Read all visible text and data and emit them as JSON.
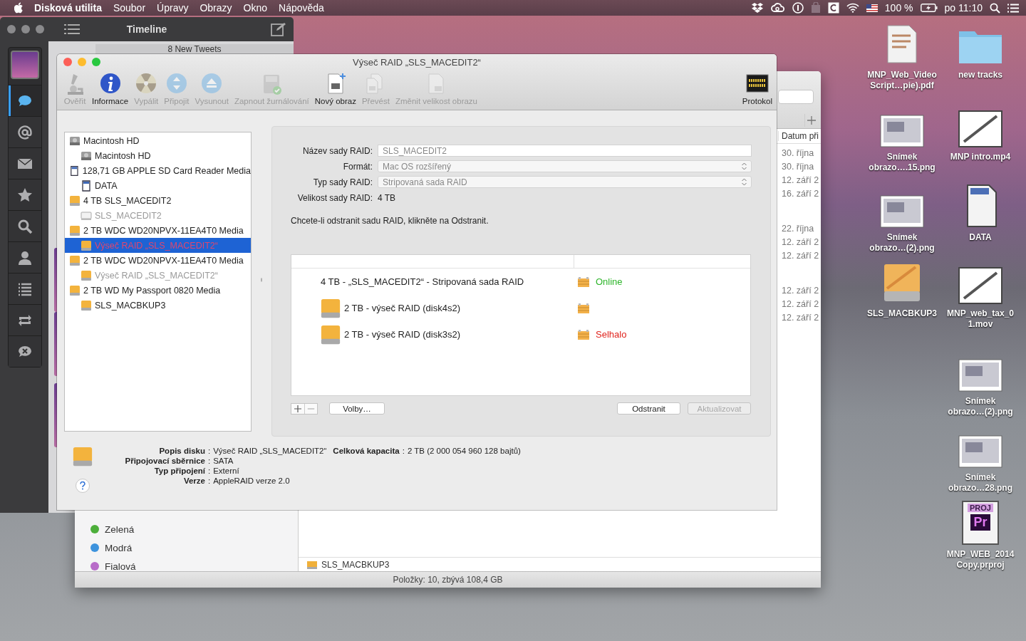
{
  "menu_bar": {
    "app": "Disková utilita",
    "items": [
      "Soubor",
      "Úpravy",
      "Obrazy",
      "Okno",
      "Nápověda"
    ],
    "battery": "100 %",
    "clock": "po 11:10"
  },
  "tweet_window": {
    "title": "Timeline",
    "banner": "8 New Tweets",
    "nav": [
      {
        "kind": "messages",
        "selected": true
      },
      {
        "kind": "mentions",
        "selected": false
      },
      {
        "kind": "mail",
        "selected": false
      },
      {
        "kind": "favorites",
        "selected": false
      },
      {
        "kind": "search",
        "selected": false
      },
      {
        "kind": "profile",
        "selected": false
      },
      {
        "kind": "lists",
        "selected": false
      },
      {
        "kind": "retweets",
        "selected": false
      },
      {
        "kind": "mutes",
        "selected": false
      }
    ]
  },
  "finder_window": {
    "date_header": "Datum při",
    "date_groups": [
      [
        "30. října",
        "30. října",
        "12. září 2",
        "16. září 2"
      ],
      [
        "22. října",
        "12. září 2",
        "12. září 2"
      ],
      [
        "12. září 2",
        "12. září 2",
        "12. září 2"
      ]
    ],
    "tags": [
      {
        "label": "Zelená",
        "color": "#4cae3a"
      },
      {
        "label": "Modrá",
        "color": "#3d93dd"
      },
      {
        "label": "Fialová",
        "color": "#b86cc9"
      }
    ],
    "path_item": "SLS_MACBKUP3",
    "status": "Položky: 10, zbývá 108,4 GB"
  },
  "disk_window": {
    "title": "Výseč RAID „SLS_MACEDIT2“",
    "toolbar": [
      {
        "kind": "verify",
        "label": "Ověřit",
        "disabled": true
      },
      {
        "kind": "info",
        "label": "Informace",
        "disabled": false
      },
      {
        "kind": "burn",
        "label": "Vypálit",
        "disabled": true
      },
      {
        "kind": "mount",
        "label": "Připojit",
        "disabled": true
      },
      {
        "kind": "eject",
        "label": "Vysunout",
        "disabled": true
      },
      {
        "kind": "journal",
        "label": "Zapnout žurnálování",
        "disabled": true
      },
      {
        "kind": "new-image",
        "label": "Nový obraz",
        "disabled": false
      },
      {
        "kind": "convert",
        "label": "Převést",
        "disabled": true
      },
      {
        "kind": "resize",
        "label": "Změnit velikost obrazu",
        "disabled": true
      },
      {
        "kind": "log",
        "label": "Protokol",
        "disabled": false
      }
    ],
    "disks": [
      {
        "kind": "hd",
        "name": "Macintosh HD",
        "selected": false,
        "disabled": false,
        "failed": false,
        "children": [
          {
            "kind": "hd",
            "name": "Macintosh HD",
            "selected": false,
            "disabled": false,
            "failed": false
          }
        ]
      },
      {
        "kind": "sd",
        "name": "128,71 GB APPLE SD Card Reader Media",
        "selected": false,
        "disabled": false,
        "failed": false,
        "children": [
          {
            "kind": "sd",
            "name": "DATA",
            "selected": false,
            "disabled": false,
            "failed": false
          }
        ]
      },
      {
        "kind": "external",
        "name": "4 TB SLS_MACEDIT2",
        "selected": false,
        "disabled": false,
        "failed": false,
        "children": [
          {
            "kind": "volume",
            "name": "SLS_MACEDIT2",
            "selected": false,
            "disabled": true,
            "failed": false
          }
        ]
      },
      {
        "kind": "external",
        "name": "2 TB WDC WD20NPVX-11EA4T0 Media",
        "selected": false,
        "disabled": false,
        "failed": false,
        "children": [
          {
            "kind": "external",
            "name": "Výseč RAID „SLS_MACEDIT2“",
            "selected": true,
            "disabled": false,
            "failed": true
          }
        ]
      },
      {
        "kind": "external",
        "name": "2 TB WDC WD20NPVX-11EA4T0 Media",
        "selected": false,
        "disabled": false,
        "failed": false,
        "children": [
          {
            "kind": "external",
            "name": "Výseč RAID „SLS_MACEDIT2“",
            "selected": false,
            "disabled": true,
            "failed": false
          }
        ]
      },
      {
        "kind": "external",
        "name": "2 TB WD My Passport 0820 Media",
        "selected": false,
        "disabled": false,
        "failed": false,
        "children": [
          {
            "kind": "external",
            "name": "SLS_MACBKUP3",
            "selected": false,
            "disabled": false,
            "failed": false
          }
        ]
      }
    ],
    "form": [
      {
        "kind": "text",
        "label": "Název sady RAID:",
        "value": "SLS_MACEDIT2"
      },
      {
        "kind": "select",
        "label": "Formát:",
        "value": "Mac OS rozšířený"
      },
      {
        "kind": "select",
        "label": "Typ sady RAID:",
        "value": "Stripovaná sada RAID"
      },
      {
        "kind": "static",
        "label": "Velikost sady RAID:",
        "value": "4 TB"
      }
    ],
    "hint": "Chcete-li odstranit sadu RAID, klikněte na Odstranit.",
    "members": [
      {
        "kind": "set",
        "name": "4 TB - „SLS_MACEDIT2“ - Stripovaná sada RAID",
        "status": "Online",
        "failed": false
      },
      {
        "kind": "slice",
        "name": "2 TB - výseč RAID (disk4s2)"
      },
      {
        "kind": "slice",
        "name": "2 TB - výseč RAID (disk3s2)",
        "status": "Selhalo",
        "failed": true
      }
    ],
    "options_button": "Volby…",
    "remove_button": {
      "label": "Odstranit",
      "disabled": false
    },
    "update_button": {
      "label": "Aktualizovat",
      "disabled": true
    },
    "info": [
      {
        "label": "Popis disku",
        "value": "Výseč RAID „SLS_MACEDIT2“",
        "extra_label": "Celková kapacita",
        "extra_value": "2 TB (2 000 054 960 128 bajtů)"
      },
      {
        "label": "Připojovací sběrnice",
        "value": "SATA"
      },
      {
        "label": "Typ připojení",
        "value": "Externí"
      },
      {
        "label": "Verze",
        "value": "AppleRAID verze 2.0"
      }
    ],
    "separator": ":"
  },
  "desktop_icons": [
    {
      "kind": "pdf",
      "lines": [
        "MNP_Web_Video",
        "Script…pie).pdf"
      ]
    },
    {
      "kind": "folder",
      "lines": [
        "new tracks"
      ]
    },
    {
      "kind": "image",
      "lines": [
        "Snímek",
        "obrazo….15.png"
      ]
    },
    {
      "kind": "video",
      "lines": [
        "MNP intro.mp4"
      ]
    },
    {
      "kind": "image",
      "lines": [
        "Snímek",
        "obrazo…(2).png"
      ]
    },
    {
      "kind": "sd",
      "lines": [
        "DATA"
      ]
    },
    {
      "kind": "drive",
      "lines": [
        "SLS_MACBKUP3"
      ]
    },
    {
      "kind": "video",
      "lines": [
        "MNP_web_tax_0",
        "1.mov"
      ]
    },
    {
      "kind": "image",
      "lines": [
        "Snímek",
        "obrazo…(2).png"
      ]
    },
    {
      "kind": "image",
      "lines": [
        "Snímek",
        "obrazo…28.png"
      ]
    },
    {
      "kind": "project",
      "lines": [
        "MNP_WEB_2014",
        "Copy.prproj"
      ],
      "badge": "PROJ",
      "glyph": "Pr"
    }
  ]
}
